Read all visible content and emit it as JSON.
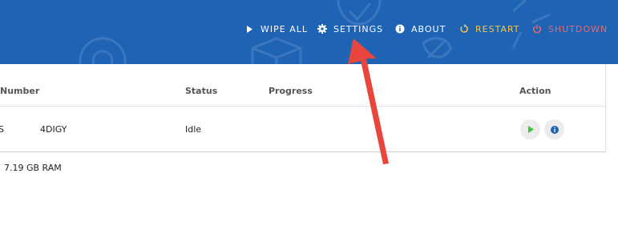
{
  "nav": {
    "wipe_all": "WIPE ALL",
    "settings": "SETTINGS",
    "about": "ABOUT",
    "restart": "RESTART",
    "shutdown": "SHUTDOWN"
  },
  "table": {
    "columns": {
      "number": "Number",
      "status": "Status",
      "progress": "Progress",
      "action": "Action"
    },
    "rows": [
      {
        "number_prefix": "S",
        "number": "4DIGY",
        "status": "Idle",
        "progress": ""
      }
    ]
  },
  "footer": {
    "ram": "7.19 GB RAM"
  },
  "colors": {
    "header_bg": "#1f63b5",
    "restart": "#f2c54a",
    "shutdown": "#e46a6a",
    "play": "#3cc23c",
    "info": "#1f63b5",
    "annotation_arrow": "#e8453c"
  },
  "icons": {
    "wipe_all": "play-triangle-icon",
    "settings": "gear-icon",
    "about": "info-icon",
    "restart": "restart-icon",
    "shutdown": "power-icon",
    "row_start": "play-icon",
    "row_info": "info-icon"
  }
}
